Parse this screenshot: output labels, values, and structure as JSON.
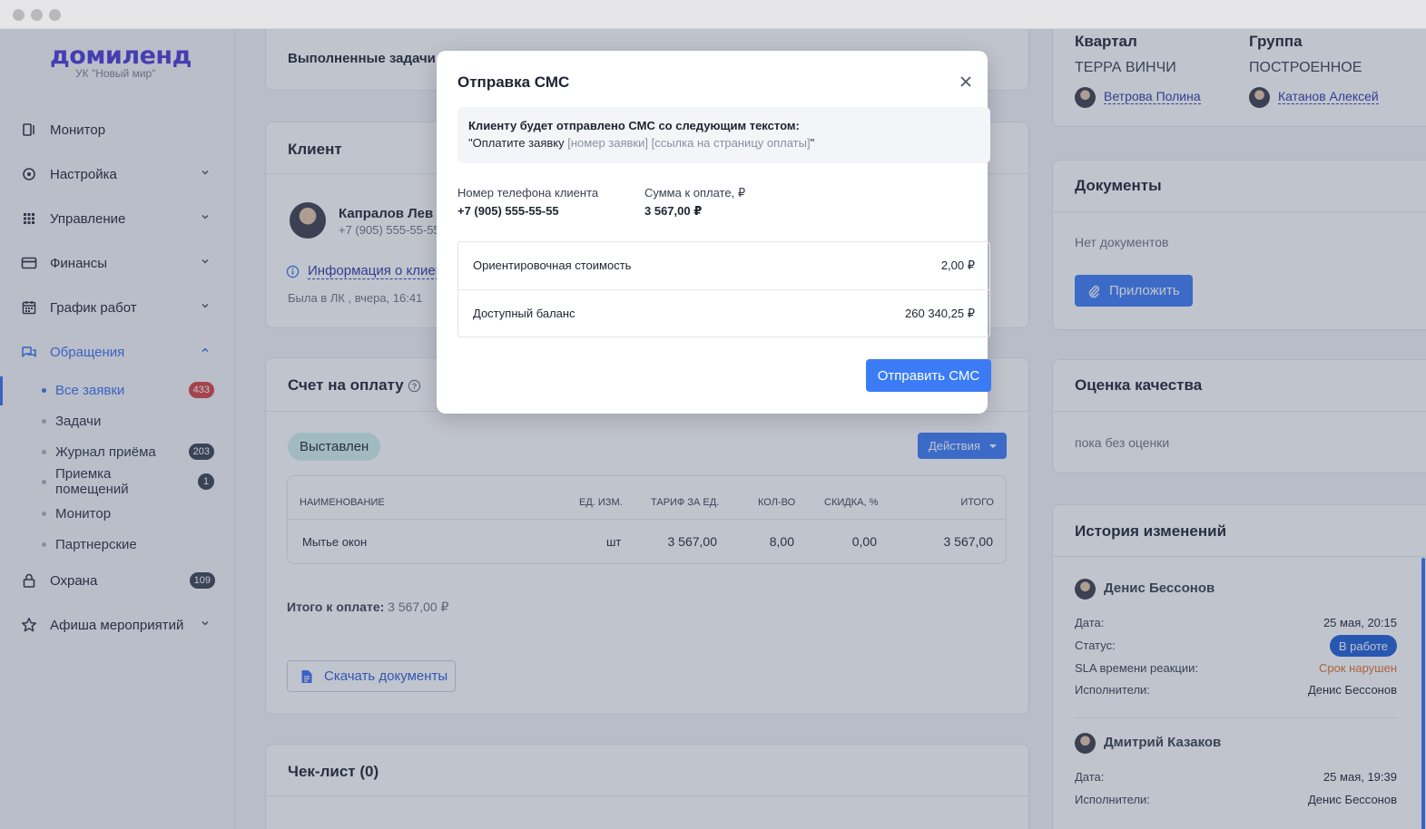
{
  "sidebar": {
    "logo": "домиленд",
    "org": "УК \"Новый мир\"",
    "nav": [
      {
        "label": "Монитор"
      },
      {
        "label": "Настройка"
      },
      {
        "label": "Управление"
      },
      {
        "label": "Финансы"
      },
      {
        "label": "График работ"
      },
      {
        "label": "Обращения"
      },
      {
        "label": "Охрана",
        "badge": "109"
      },
      {
        "label": "Афиша мероприятий"
      }
    ],
    "sub": [
      {
        "label": "Все заявки",
        "badge": "433"
      },
      {
        "label": "Задачи"
      },
      {
        "label": "Журнал приёма",
        "badge": "203"
      },
      {
        "label": "Приемка помещений",
        "badge": "1"
      },
      {
        "label": "Монитор"
      },
      {
        "label": "Партнерские"
      }
    ]
  },
  "tasks": {
    "title": "Выполненные задачи ("
  },
  "client": {
    "title": "Клиент",
    "name": "Капралов Лев",
    "phone": "+7 (905) 555-55-55",
    "info_link": "Информация о клиен",
    "last_seen": "Была в ЛК , вчера, 16:41"
  },
  "invoice": {
    "title": "Счет на оплату",
    "status": "Выставлен",
    "actions": "Действия",
    "headers": [
      "НАИМЕНОВАНИЕ",
      "ЕД. ИЗМ.",
      "ТАРИФ ЗА ЕД.",
      "КОЛ-ВО",
      "СКИДКА, %",
      "ИТОГО"
    ],
    "rows": [
      [
        "Мытье окон",
        "шт",
        "3 567,00",
        "8,00",
        "0,00",
        "3 567,00"
      ]
    ],
    "total_label": "Итого к оплате:",
    "total_value": "3 567,00 ₽",
    "download": "Скачать документы"
  },
  "checklist": {
    "title": "Чек-лист (0)"
  },
  "quarter": {
    "label": "Квартал",
    "value": "ТЕРРА ВИНЧИ",
    "person": "Ветрова Полина"
  },
  "group": {
    "label": "Группа",
    "value": "ПОСТРОЕННОЕ",
    "person": "Катанов Алексей"
  },
  "documents": {
    "title": "Документы",
    "empty": "Нет документов",
    "attach": "Приложить"
  },
  "quality": {
    "title": "Оценка качества",
    "value": "пока без оценки"
  },
  "history": {
    "title": "История изменений",
    "entries": [
      {
        "author": "Денис Бессонов",
        "date_label": "Дата:",
        "date": "25 мая, 20:15",
        "status_label": "Статус:",
        "status": "В работе",
        "sla_label": "SLA времени реакции:",
        "sla": "Срок нарушен",
        "exec_label": "Исполнители:",
        "exec": "Денис Бессонов"
      },
      {
        "author": "Дмитрий Казаков",
        "date_label": "Дата:",
        "date": "25 мая, 19:39",
        "exec_label": "Исполнители:",
        "exec": "Денис Бессонов"
      }
    ]
  },
  "modal": {
    "title": "Отправка СМС",
    "note_heading": "Клиенту будет отправлено СМС со следующим текстом:",
    "note_prefix": "\"Оплатите заявку ",
    "note_placeholder": "[номер заявки] [ссылка на страницу оплаты]",
    "note_suffix": "\"",
    "phone_label": "Номер телефона клиента",
    "phone": "+7 (905) 555-55-55",
    "sum_label": "Сумма к оплате, ₽",
    "sum": "3 567,00 ₽",
    "cost_label": "Ориентировочная стоимость",
    "cost": "2,00 ₽",
    "balance_label": "Доступный баланс",
    "balance": "260 340,25 ₽",
    "send": "Отправить СМС"
  },
  "colors": {
    "accent": "#3b7cf6",
    "brand": "#4b3ad6",
    "danger": "#d64545",
    "sla_warning": "#e0742f"
  }
}
